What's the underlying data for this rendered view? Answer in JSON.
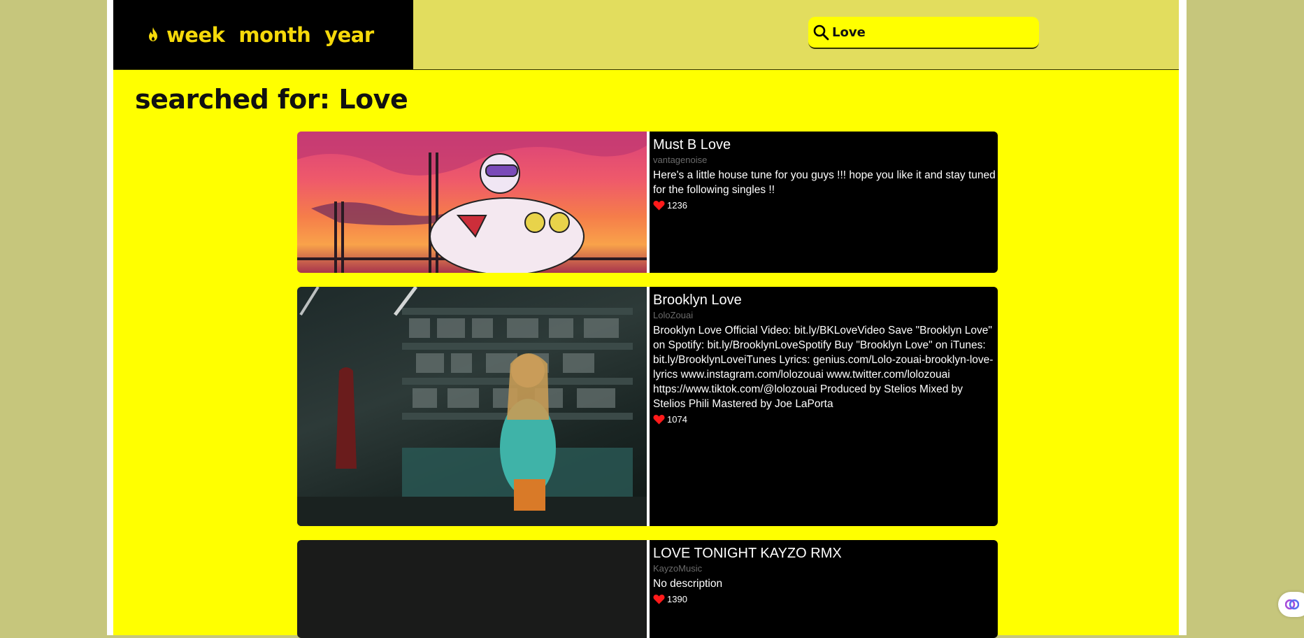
{
  "nav": {
    "flame_icon": "flame-icon",
    "links": [
      "week",
      "month",
      "year"
    ]
  },
  "search": {
    "value": "Love",
    "icon": "search-icon"
  },
  "heading": "searched for: Love",
  "results": [
    {
      "title": "Must B Love",
      "author": "vantagenoise",
      "description": "Here's a little house tune for you guys !!! hope you like it and stay tuned for the following singles !!",
      "likes": "1236"
    },
    {
      "title": "Brooklyn Love",
      "author": "LoloZouai",
      "description": "Brooklyn Love Official Video: bit.ly/BKLoveVideo Save \"Brooklyn Love\" on Spotify: bit.ly/BrooklynLoveSpotify Buy \"Brooklyn Love\" on iTunes: bit.ly/BrooklynLoveiTunes Lyrics: genius.com/Lolo-zouai-brooklyn-love-lyrics www.instagram.com/lolozouai www.twitter.com/lolozouai https://www.tiktok.com/@lolozouai Produced by Stelios Mixed by Stelios Phili Mastered by Joe LaPorta",
      "likes": "1074"
    },
    {
      "title": "LOVE TONIGHT KAYZO RMX",
      "author": "KayzoMusic",
      "description": "No description",
      "likes": "1390"
    }
  ],
  "colors": {
    "accent": "#ffff00",
    "header_bg": "#e2dd5e",
    "nav_text": "#f5d90a",
    "heart": "#ff1a1a"
  }
}
